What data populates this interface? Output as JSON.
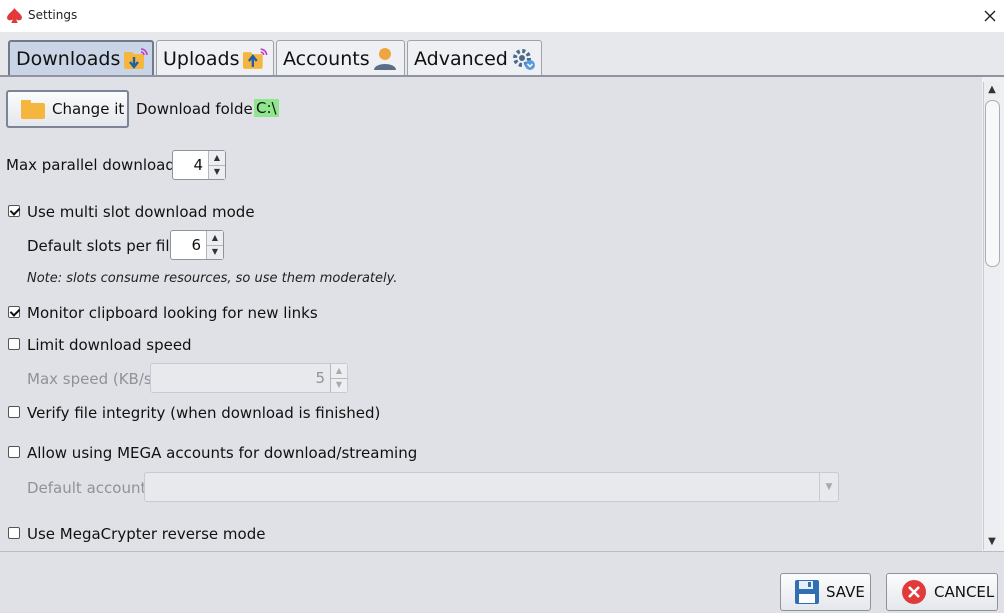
{
  "window": {
    "title": "Settings"
  },
  "tabs": [
    {
      "label": "Downloads",
      "active": true
    },
    {
      "label": "Uploads",
      "active": false
    },
    {
      "label": "Accounts",
      "active": false
    },
    {
      "label": "Advanced",
      "active": false
    }
  ],
  "downloads": {
    "change_button": "Change it",
    "folder_label": "Download folder:",
    "folder_value": "C:\\",
    "max_parallel_label": "Max parallel downloads:",
    "max_parallel_value": "4",
    "multi_slot_label": "Use multi slot download mode",
    "multi_slot_checked": true,
    "slots_label": "Default slots per file:",
    "slots_value": "6",
    "note": "Note: slots consume resources, so use them moderately.",
    "monitor_label": "Monitor clipboard looking for new links",
    "monitor_checked": true,
    "limit_label": "Limit download speed",
    "limit_checked": false,
    "max_speed_label": "Max speed (KB/s):",
    "max_speed_value": "5",
    "verify_label": "Verify file integrity (when download is finished)",
    "verify_checked": false,
    "mega_label": "Allow using MEGA accounts for download/streaming",
    "mega_checked": false,
    "default_account_label": "Default account:",
    "default_account_value": "",
    "reverse_label": "Use MegaCrypter reverse mode",
    "reverse_checked": false
  },
  "footer": {
    "save_label": "SAVE",
    "cancel_label": "CANCEL"
  },
  "colors": {
    "folder_highlight": "#8fe68f",
    "active_tab": "#c9d4e6",
    "cancel_icon": "#e03a3a",
    "save_icon": "#2f6fb2"
  }
}
